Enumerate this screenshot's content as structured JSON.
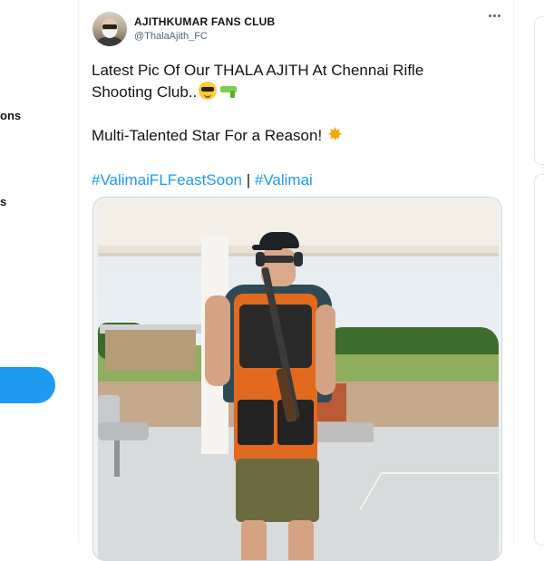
{
  "left_nav": {
    "items": [
      {
        "label": "ons"
      },
      {
        "label": "s"
      }
    ],
    "accent_color": "#1d9bf0"
  },
  "tweet": {
    "author": {
      "name": "AJITHKUMAR FANS CLUB",
      "handle": "@ThalaAjith_FC"
    },
    "more_icon": "more-horizontal-icon",
    "text": {
      "line1": "Latest Pic Of Our THALA AJITH At Chennai Rifle",
      "line2": "Shooting Club..",
      "line3": "Multi-Talented Star For a Reason!"
    },
    "emoji": [
      "sunglasses-face-emoji",
      "water-pistol-emoji",
      "star-emoji"
    ],
    "hashtags": [
      "#ValimaiFLFeastSoon",
      "#Valimai"
    ],
    "hashtag_separator": "|",
    "hashtag_color": "#1d9bf0",
    "media_description": "photo"
  }
}
